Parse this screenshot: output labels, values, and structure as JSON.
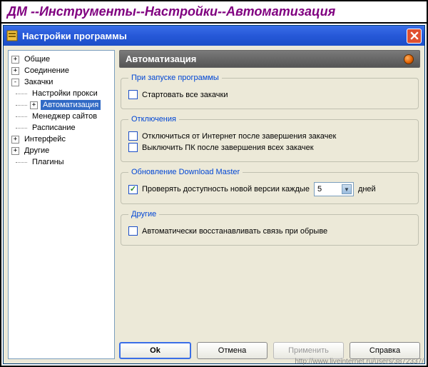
{
  "header": {
    "title": "ДМ --Инструменты--Настройки--Автоматизация"
  },
  "window": {
    "title": "Настройки программы"
  },
  "tree": {
    "items": [
      {
        "label": "Общие",
        "lvl": 0,
        "exp": "+",
        "sel": false
      },
      {
        "label": "Соединение",
        "lvl": 0,
        "exp": "+",
        "sel": false
      },
      {
        "label": "Закачки",
        "lvl": 0,
        "exp": "-",
        "sel": false
      },
      {
        "label": "Настройки прокси",
        "lvl": 1,
        "exp": "",
        "sel": false
      },
      {
        "label": "Автоматизация",
        "lvl": 1,
        "exp": "+",
        "sel": true
      },
      {
        "label": "Менеджер сайтов",
        "lvl": 1,
        "exp": "",
        "sel": false
      },
      {
        "label": "Расписание",
        "lvl": 1,
        "exp": "",
        "sel": false
      },
      {
        "label": "Интерфейс",
        "lvl": 0,
        "exp": "+",
        "sel": false
      },
      {
        "label": "Другие",
        "lvl": 0,
        "exp": "+",
        "sel": false
      },
      {
        "label": "Плагины",
        "lvl": 1,
        "exp": "",
        "sel": false
      }
    ]
  },
  "section": {
    "title": "Автоматизация"
  },
  "groups": {
    "startup": {
      "legend": "При запуске программы",
      "start_all": {
        "label": "Стартовать все закачки",
        "checked": false
      }
    },
    "shutdown": {
      "legend": "Отключения",
      "disconnect": {
        "label": "Отключиться от Интернет после завершения закачек",
        "checked": false
      },
      "shutdown_pc": {
        "label": "Выключить ПК после завершения всех закачек",
        "checked": false
      }
    },
    "update": {
      "legend": "Обновление Download Master",
      "check_update": {
        "label": "Проверять доступность новой версии каждые",
        "checked": true
      },
      "days_value": "5",
      "days_suffix": "дней"
    },
    "other": {
      "legend": "Другие",
      "auto_reconnect": {
        "label": "Автоматически восстанавливать связь при обрыве",
        "checked": false
      }
    }
  },
  "buttons": {
    "ok": "Ok",
    "cancel": "Отмена",
    "apply": "Применить",
    "help": "Справка"
  },
  "watermark": "http://www.liveinternet.ru/users/3872337/"
}
